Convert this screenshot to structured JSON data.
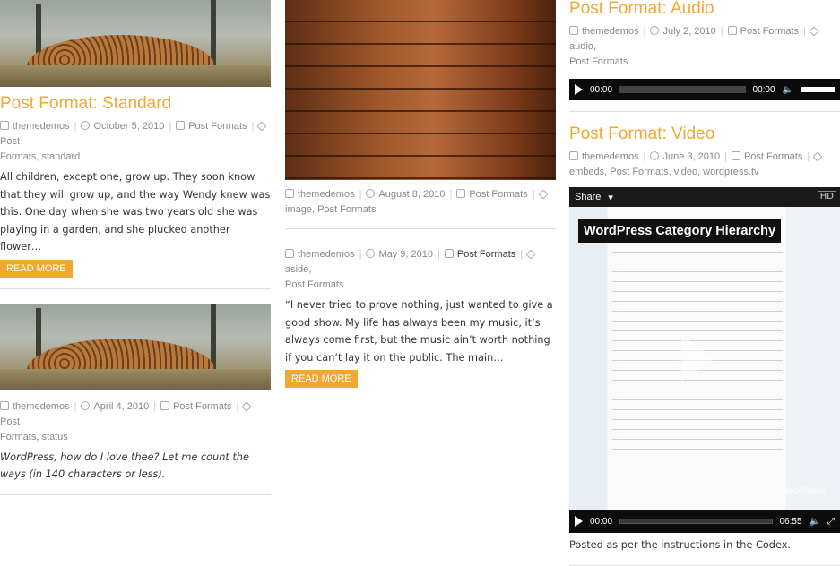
{
  "col1": {
    "post1": {
      "title": "Post Format: Standard",
      "author": "themedemos",
      "date": "October 5, 2010",
      "category": "Post Formats",
      "tag_label": "Post",
      "tags_line2": "Formats, standard",
      "excerpt": "All children, except one, grow up. They soon know that they will grow up, and the way Wendy knew was this. One day when she was two years old she was playing in a garden, and she plucked another flower…",
      "button": "READ MORE"
    },
    "post2": {
      "author": "themedemos",
      "date": "April 4, 2010",
      "category": "Post Formats",
      "tag_label": "Post",
      "tags_line2": "Formats, status",
      "excerpt": "WordPress, how do I love thee? Let me count the ways (in 140 characters or less)."
    }
  },
  "col2": {
    "post1": {
      "author": "themedemos",
      "date": "August 8, 2010",
      "category": "Post Formats",
      "tags_line2": "image, Post Formats"
    },
    "post2": {
      "author": "themedemos",
      "date": "May 9, 2010",
      "category": "Post Formats",
      "tag_label": "aside,",
      "tags_line2": "Post Formats",
      "excerpt": "“I never tried to prove nothing, just wanted to give a good show. My life has always been my music, it’s always come first, but the music ain’t worth nothing if you can’t lay it on the public. The main…",
      "button": "READ MORE"
    }
  },
  "col3": {
    "audio_post": {
      "title": "Post Format: Audio",
      "author": "themedemos",
      "date": "July 2, 2010",
      "category": "Post Formats",
      "tag_label": "audio,",
      "tags_line2": "Post Formats",
      "player": {
        "current": "00:00",
        "duration": "00:00"
      }
    },
    "video_post": {
      "title": "Post Format: Video",
      "author": "themedemos",
      "date": "June 3, 2010",
      "category": "Post Formats",
      "tags_line2": "embeds, Post Formats, video, wordpress.tv",
      "video": {
        "share": "Share",
        "hd": "HD",
        "title": "WordPress Category Hierarchy",
        "brand": "VideoPress",
        "current": "00:00",
        "duration": "06:55"
      },
      "caption": "Posted as per the instructions in the Codex."
    }
  },
  "colors": {
    "accent": "#f0a830",
    "meta": "#888888",
    "text": "#333333"
  },
  "icons": [
    "author-icon",
    "clock-icon",
    "folder-icon",
    "tag-icon",
    "play-icon",
    "volume-icon",
    "fullscreen-icon"
  ]
}
